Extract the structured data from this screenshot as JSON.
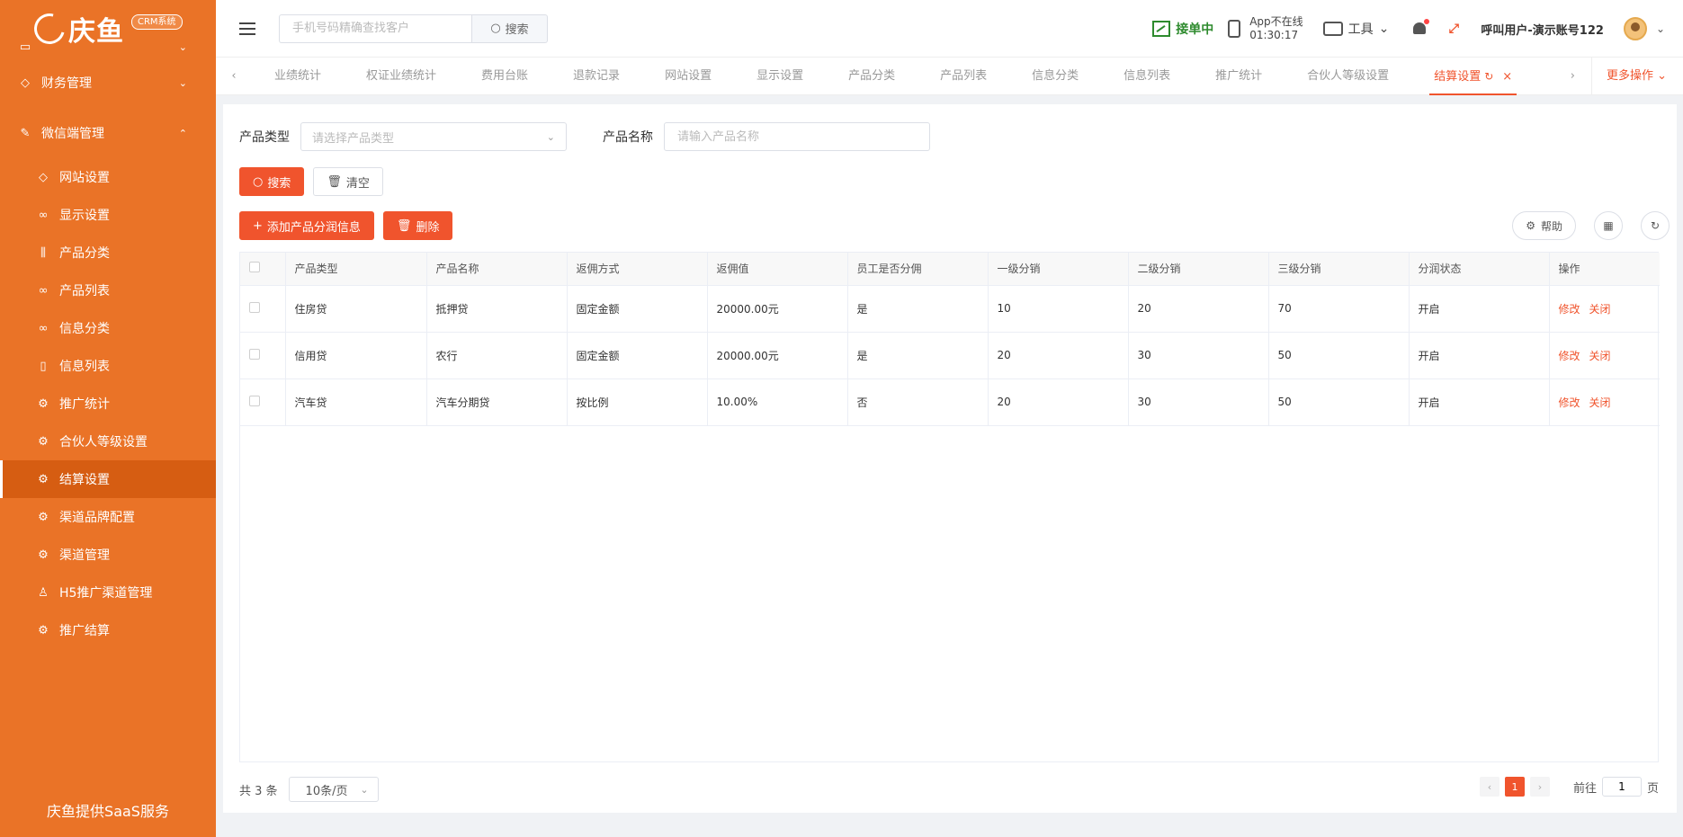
{
  "brand": {
    "logo_text": "庆鱼",
    "badge": "CRM系统",
    "footer": "庆鱼提供SaaS服务"
  },
  "sidebar": {
    "partial_item": {
      "label": "",
      "icon": "folder-icon"
    },
    "groups": [
      {
        "label": "财务管理",
        "icon": "diamond-icon",
        "expanded": false
      },
      {
        "label": "微信端管理",
        "icon": "edit-icon",
        "expanded": true
      }
    ],
    "items": [
      {
        "label": "网站设置",
        "icon": "diamond-icon",
        "active": false
      },
      {
        "label": "显示设置",
        "icon": "glasses-icon",
        "active": false
      },
      {
        "label": "产品分类",
        "icon": "bars-icon",
        "active": false
      },
      {
        "label": "产品列表",
        "icon": "glasses-icon",
        "active": false
      },
      {
        "label": "信息分类",
        "icon": "glasses-icon",
        "active": false
      },
      {
        "label": "信息列表",
        "icon": "book-icon",
        "active": false
      },
      {
        "label": "推广统计",
        "icon": "gear-icon",
        "active": false
      },
      {
        "label": "合伙人等级设置",
        "icon": "gear-icon",
        "active": false
      },
      {
        "label": "结算设置",
        "icon": "gear-icon",
        "active": true
      },
      {
        "label": "渠道品牌配置",
        "icon": "gear-icon",
        "active": false
      },
      {
        "label": "渠道管理",
        "icon": "gear-icon",
        "active": false
      },
      {
        "label": "H5推广渠道管理",
        "icon": "user-icon",
        "active": false
      },
      {
        "label": "推广结算",
        "icon": "gear-icon",
        "active": false
      }
    ]
  },
  "header": {
    "search_placeholder": "手机号码精确查找客户",
    "search_button": "搜索",
    "jiedan": "接单中",
    "app_status": "App不在线",
    "app_time": "01:30:17",
    "tools": "工具",
    "user_name": "呼叫用户-演示账号122"
  },
  "tabs": {
    "items": [
      {
        "label": "业绩统计",
        "active": false
      },
      {
        "label": "权证业绩统计",
        "active": false
      },
      {
        "label": "费用台账",
        "active": false
      },
      {
        "label": "退款记录",
        "active": false
      },
      {
        "label": "网站设置",
        "active": false
      },
      {
        "label": "显示设置",
        "active": false
      },
      {
        "label": "产品分类",
        "active": false
      },
      {
        "label": "产品列表",
        "active": false
      },
      {
        "label": "信息分类",
        "active": false
      },
      {
        "label": "信息列表",
        "active": false
      },
      {
        "label": "推广统计",
        "active": false
      },
      {
        "label": "合伙人等级设置",
        "active": false
      },
      {
        "label": "结算设置",
        "active": true
      }
    ],
    "more": "更多操作"
  },
  "filters": {
    "product_type_label": "产品类型",
    "product_type_placeholder": "请选择产品类型",
    "product_name_label": "产品名称",
    "product_name_placeholder": "请输入产品名称",
    "search": "搜索",
    "clear": "清空"
  },
  "actions": {
    "add": "添加产品分润信息",
    "delete": "删除",
    "help": "帮助"
  },
  "table": {
    "columns": [
      "产品类型",
      "产品名称",
      "返佣方式",
      "返佣值",
      "员工是否分佣",
      "一级分销",
      "二级分销",
      "三级分销",
      "分润状态",
      "操作"
    ],
    "rows": [
      [
        "住房贷",
        "抵押贷",
        "固定金额",
        "20000.00元",
        "是",
        "10",
        "20",
        "70",
        "开启"
      ],
      [
        "信用贷",
        "农行",
        "固定金额",
        "20000.00元",
        "是",
        "20",
        "30",
        "50",
        "开启"
      ],
      [
        "汽车贷",
        "汽车分期贷",
        "按比例",
        "10.00%",
        "否",
        "20",
        "30",
        "50",
        "开启"
      ]
    ],
    "op_edit": "修改",
    "op_close": "关闭"
  },
  "pagination": {
    "total": "共 3 条",
    "page_size": "10条/页",
    "current": "1",
    "goto_label": "前往",
    "goto_value": "1",
    "page_suffix": "页"
  },
  "colors": {
    "sidebar": "#ea7327",
    "accent": "#f0542d",
    "active_menu": "#d65d12",
    "online": "#2e8b2e"
  }
}
